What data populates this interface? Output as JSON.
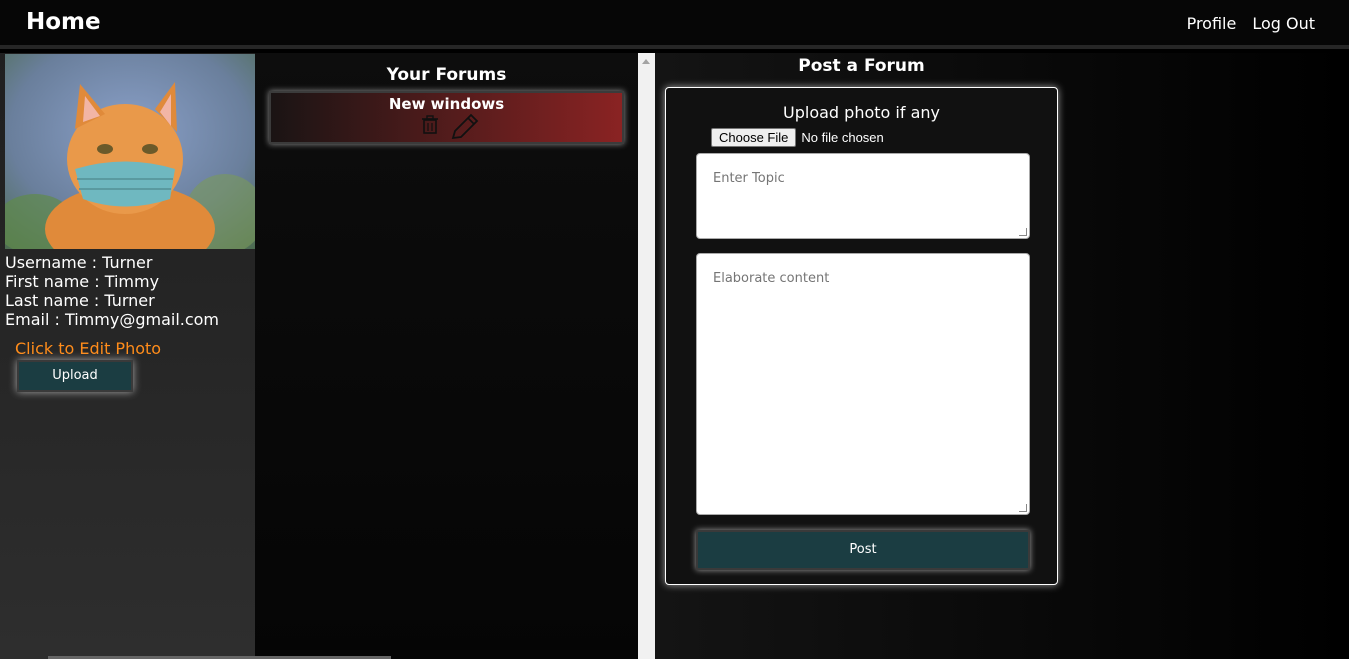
{
  "header": {
    "brand": "Home",
    "nav": {
      "profile": "Profile",
      "logout": "Log Out"
    }
  },
  "sidebar": {
    "avatar_alt": "cat wearing face mask",
    "info": [
      "Username : Turner",
      "First name : Timmy",
      "Last name : Turner",
      "Email : Timmy@gmail.com"
    ],
    "edit_photo_label": "Click to Edit Photo",
    "upload_button": "Upload"
  },
  "forums": {
    "title": "Your Forums",
    "items": [
      {
        "title": "New windows",
        "icons": [
          "trash-icon",
          "pencil-icon"
        ]
      }
    ]
  },
  "post_form": {
    "title": "Post a Forum",
    "upload_label": "Upload photo if any",
    "file_button": "Choose File",
    "file_status": "No file chosen",
    "topic_placeholder": "Enter Topic",
    "content_placeholder": "Elaborate content",
    "post_button": "Post"
  },
  "colors": {
    "accent_orange": "#ff8c1a",
    "button_teal": "#1b3d42",
    "card_red": "#8a2323"
  }
}
